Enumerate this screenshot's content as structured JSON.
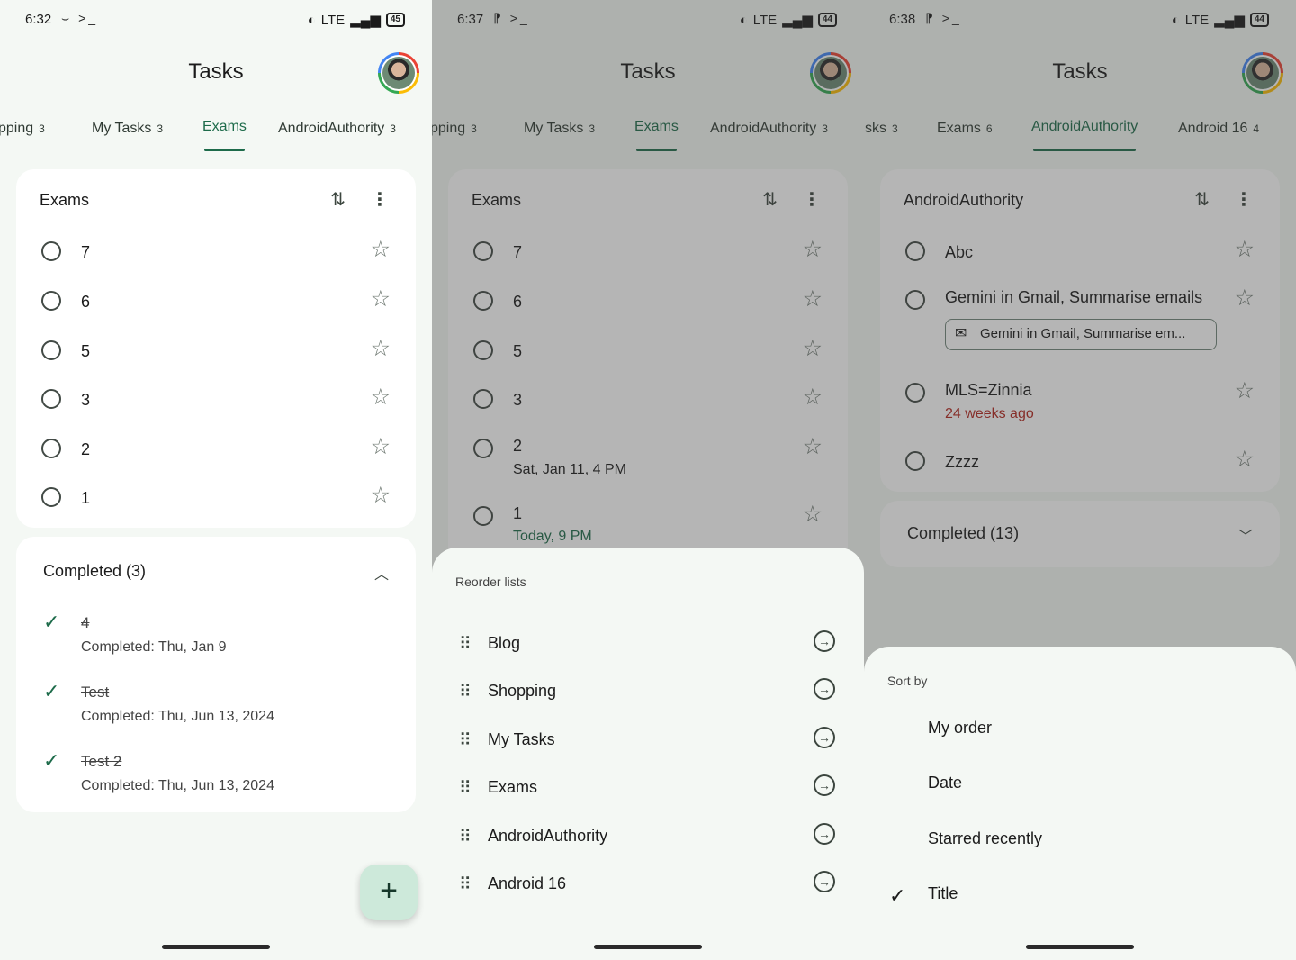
{
  "screens": [
    {
      "status": {
        "time": "6:32",
        "icons": "⌣ >_",
        "network": "LTE",
        "battery": "45"
      },
      "app_title": "Tasks",
      "tabs": [
        {
          "label": "pping",
          "count": "3"
        },
        {
          "label": "My Tasks",
          "count": "3"
        },
        {
          "label": "Exams",
          "count": ""
        },
        {
          "label": "AndroidAuthority",
          "count": "3"
        }
      ],
      "list_title": "Exams",
      "tasks": [
        {
          "title": "7"
        },
        {
          "title": "6"
        },
        {
          "title": "5"
        },
        {
          "title": "3"
        },
        {
          "title": "2"
        },
        {
          "title": "1"
        }
      ],
      "completed": {
        "header": "Completed (3)",
        "items": [
          {
            "title": "4",
            "sub": "Completed: Thu, Jan 9"
          },
          {
            "title": "Test",
            "sub": "Completed: Thu, Jun 13, 2024"
          },
          {
            "title": "Test 2",
            "sub": "Completed: Thu, Jun 13, 2024"
          }
        ]
      },
      "fab": "+"
    },
    {
      "status": {
        "time": "6:37",
        "icons": "⁋ >_",
        "network": "LTE",
        "battery": "44"
      },
      "app_title": "Tasks",
      "tabs": [
        {
          "label": "pping",
          "count": "3"
        },
        {
          "label": "My Tasks",
          "count": "3"
        },
        {
          "label": "Exams",
          "count": ""
        },
        {
          "label": "AndroidAuthority",
          "count": "3"
        }
      ],
      "list_title": "Exams",
      "tasks": [
        {
          "title": "7"
        },
        {
          "title": "6"
        },
        {
          "title": "5"
        },
        {
          "title": "3"
        },
        {
          "title": "2",
          "sub": "Sat, Jan 11, 4 PM"
        },
        {
          "title": "1",
          "sub": "Today, 9 PM"
        }
      ],
      "reorder": {
        "title": "Reorder lists",
        "items": [
          "Blog",
          "Shopping",
          "My Tasks",
          "Exams",
          "AndroidAuthority",
          "Android 16"
        ]
      }
    },
    {
      "status": {
        "time": "6:38",
        "icons": "⁋ >_",
        "network": "LTE",
        "battery": "44"
      },
      "app_title": "Tasks",
      "tabs": [
        {
          "label": "sks",
          "count": "3"
        },
        {
          "label": "Exams",
          "count": "6"
        },
        {
          "label": "AndroidAuthority",
          "count": ""
        },
        {
          "label": "Android 16",
          "count": "4"
        }
      ],
      "list_title": "AndroidAuthority",
      "tasks": [
        {
          "title": "Abc"
        },
        {
          "title": "Gemini in Gmail, Summarise emails",
          "chip": "Gemini in Gmail, Summarise em..."
        },
        {
          "title": "MLS=Zinnia",
          "sub": "24 weeks ago"
        },
        {
          "title": "Zzzz"
        }
      ],
      "completed_header": "Completed (13)",
      "sort": {
        "title": "Sort by",
        "options": [
          "My order",
          "Date",
          "Starred recently",
          "Title"
        ],
        "selected": "Title"
      }
    }
  ],
  "colors": {
    "accent": "#1d6b4a",
    "overdue": "#b3261e",
    "today": "#1d6b4a",
    "surface": "#f4f8f4",
    "card": "#ffffff"
  }
}
